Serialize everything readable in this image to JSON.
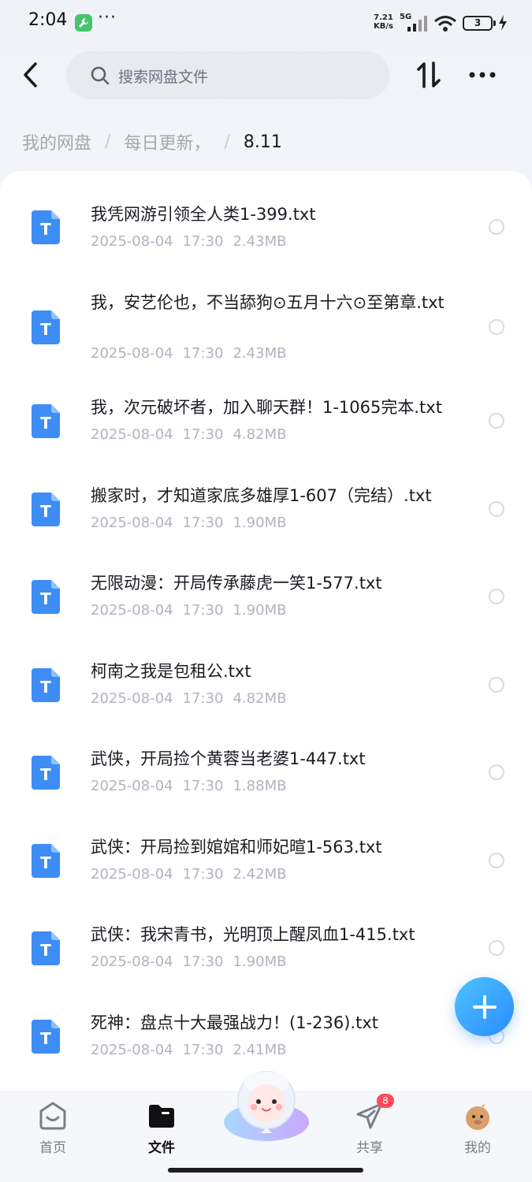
{
  "status_bar": {
    "time": "2:04",
    "dots": "···",
    "net_speed_value": "7.21",
    "net_speed_unit": "KB/s",
    "network": "5G",
    "battery": "3"
  },
  "search": {
    "placeholder": "搜索网盘文件"
  },
  "breadcrumb": {
    "items": [
      "我的网盘",
      "每日更新，",
      "8.11"
    ],
    "separator": "/"
  },
  "files": [
    {
      "name": "我凭网游引领全人类1-399.txt",
      "date": "2025-08-04",
      "time": "17:30",
      "size": "2.43MB",
      "type_letter": "T"
    },
    {
      "name": "我，安艺伦也，不当舔狗⊙五月十六⊙至第章.txt",
      "date": "2025-08-04",
      "time": "17:30",
      "size": "2.43MB",
      "type_letter": "T"
    },
    {
      "name": "我，次元破坏者，加入聊天群！1-1065完本.txt",
      "date": "2025-08-04",
      "time": "17:30",
      "size": "4.82MB",
      "type_letter": "T"
    },
    {
      "name": "搬家时，才知道家底多雄厚1-607（完结）.txt",
      "date": "2025-08-04",
      "time": "17:30",
      "size": "1.90MB",
      "type_letter": "T"
    },
    {
      "name": "无限动漫：开局传承藤虎一笑1-577.txt",
      "date": "2025-08-04",
      "time": "17:30",
      "size": "1.90MB",
      "type_letter": "T"
    },
    {
      "name": "柯南之我是包租公.txt",
      "date": "2025-08-04",
      "time": "17:30",
      "size": "4.82MB",
      "type_letter": "T"
    },
    {
      "name": "武侠，开局捡个黄蓉当老婆1-447.txt",
      "date": "2025-08-04",
      "time": "17:30",
      "size": "1.88MB",
      "type_letter": "T"
    },
    {
      "name": "武侠：开局捡到婠婠和师妃暄1-563.txt",
      "date": "2025-08-04",
      "time": "17:30",
      "size": "2.42MB",
      "type_letter": "T"
    },
    {
      "name": "武侠：我宋青书，光明顶上醒凤血1-415.txt",
      "date": "2025-08-04",
      "time": "17:30",
      "size": "1.90MB",
      "type_letter": "T"
    },
    {
      "name": "死神：盘点十大最强战力！(1-236).txt",
      "date": "2025-08-04",
      "time": "17:30",
      "size": "2.41MB",
      "type_letter": "T"
    }
  ],
  "bottom_nav": {
    "items": [
      {
        "label": "首页",
        "icon": "home-face-icon"
      },
      {
        "label": "文件",
        "icon": "folder-icon",
        "active": true
      },
      {
        "label": "共享",
        "icon": "paper-plane-icon",
        "badge": "8"
      },
      {
        "label": "我的",
        "icon": "avatar-icon"
      }
    ]
  },
  "colors": {
    "accent": "#2f8cff",
    "file_icon": "#3d8df5",
    "badge": "#ff4a5a"
  }
}
